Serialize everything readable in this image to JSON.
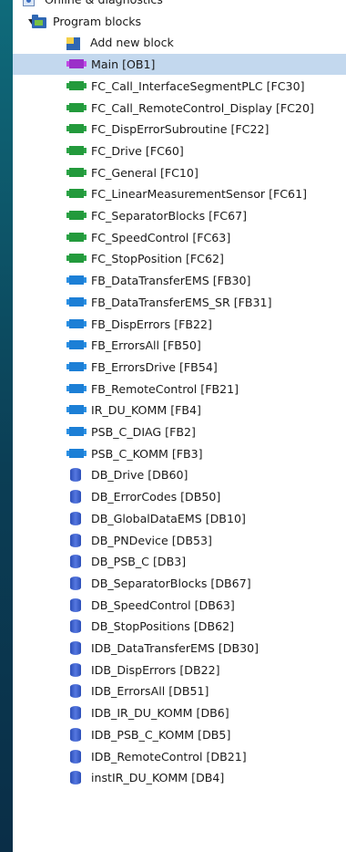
{
  "tree": {
    "items": [
      {
        "label": "Online & diagnostics",
        "icon": "diagnostics-icon",
        "kind": "diag"
      },
      {
        "label": "Program blocks",
        "icon": "folder-icon",
        "kind": "folder",
        "expanded": true
      },
      {
        "label": "Add new block",
        "icon": "add-block-icon",
        "kind": "add"
      },
      {
        "label": "Main [OB1]",
        "icon": "organization-block-icon",
        "kind": "ob",
        "selected": true
      },
      {
        "label": "FC_Call_InterfaceSegmentPLC [FC30]",
        "icon": "function-icon",
        "kind": "fc"
      },
      {
        "label": "FC_Call_RemoteControl_Display [FC20]",
        "icon": "function-icon",
        "kind": "fc"
      },
      {
        "label": "FC_DispErrorSubroutine [FC22]",
        "icon": "function-icon",
        "kind": "fc"
      },
      {
        "label": "FC_Drive [FC60]",
        "icon": "function-icon",
        "kind": "fc"
      },
      {
        "label": "FC_General [FC10]",
        "icon": "function-icon",
        "kind": "fc"
      },
      {
        "label": "FC_LinearMeasurementSensor [FC61]",
        "icon": "function-icon",
        "kind": "fc"
      },
      {
        "label": "FC_SeparatorBlocks [FC67]",
        "icon": "function-icon",
        "kind": "fc"
      },
      {
        "label": "FC_SpeedControl [FC63]",
        "icon": "function-icon",
        "kind": "fc"
      },
      {
        "label": "FC_StopPosition [FC62]",
        "icon": "function-icon",
        "kind": "fc"
      },
      {
        "label": "FB_DataTransferEMS [FB30]",
        "icon": "function-block-icon",
        "kind": "fb"
      },
      {
        "label": "FB_DataTransferEMS_SR [FB31]",
        "icon": "function-block-icon",
        "kind": "fb"
      },
      {
        "label": "FB_DispErrors [FB22]",
        "icon": "function-block-icon",
        "kind": "fb"
      },
      {
        "label": "FB_ErrorsAll [FB50]",
        "icon": "function-block-icon",
        "kind": "fb"
      },
      {
        "label": "FB_ErrorsDrive [FB54]",
        "icon": "function-block-icon",
        "kind": "fb"
      },
      {
        "label": "FB_RemoteControl [FB21]",
        "icon": "function-block-icon",
        "kind": "fb"
      },
      {
        "label": "IR_DU_KOMM [FB4]",
        "icon": "function-block-icon",
        "kind": "fb"
      },
      {
        "label": "PSB_C_DIAG [FB2]",
        "icon": "function-block-icon",
        "kind": "fb"
      },
      {
        "label": "PSB_C_KOMM [FB3]",
        "icon": "function-block-icon",
        "kind": "fb"
      },
      {
        "label": "DB_Drive [DB60]",
        "icon": "data-block-icon",
        "kind": "db"
      },
      {
        "label": "DB_ErrorCodes [DB50]",
        "icon": "data-block-icon",
        "kind": "db"
      },
      {
        "label": "DB_GlobalDataEMS [DB10]",
        "icon": "data-block-icon",
        "kind": "db"
      },
      {
        "label": "DB_PNDevice [DB53]",
        "icon": "data-block-icon",
        "kind": "db"
      },
      {
        "label": "DB_PSB_C [DB3]",
        "icon": "data-block-icon",
        "kind": "db"
      },
      {
        "label": "DB_SeparatorBlocks [DB67]",
        "icon": "data-block-icon",
        "kind": "db"
      },
      {
        "label": "DB_SpeedControl [DB63]",
        "icon": "data-block-icon",
        "kind": "db"
      },
      {
        "label": "DB_StopPositions [DB62]",
        "icon": "data-block-icon",
        "kind": "db"
      },
      {
        "label": "IDB_DataTransferEMS [DB30]",
        "icon": "data-block-icon",
        "kind": "db"
      },
      {
        "label": "IDB_DispErrors [DB22]",
        "icon": "data-block-icon",
        "kind": "db"
      },
      {
        "label": "IDB_ErrorsAll [DB51]",
        "icon": "data-block-icon",
        "kind": "db"
      },
      {
        "label": "IDB_IR_DU_KOMM [DB6]",
        "icon": "data-block-icon",
        "kind": "db"
      },
      {
        "label": "IDB_PSB_C_KOMM [DB5]",
        "icon": "data-block-icon",
        "kind": "db"
      },
      {
        "label": "IDB_RemoteControl [DB21]",
        "icon": "data-block-icon",
        "kind": "db"
      },
      {
        "label": "instIR_DU_KOMM [DB4]",
        "icon": "data-block-icon",
        "kind": "db"
      }
    ]
  },
  "colors": {
    "selection": "#c3d8ee",
    "fc_icon": "#239a3c",
    "fb_icon": "#1c7fd6",
    "ob_icon": "#9b2fc9",
    "db_icon": "#2c4fb8"
  }
}
